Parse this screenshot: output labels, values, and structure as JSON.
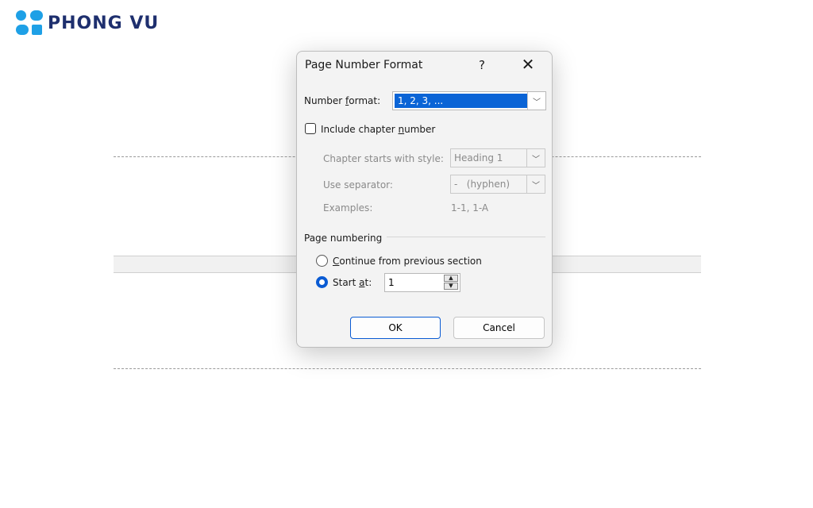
{
  "brand": {
    "name": "PHONG VU",
    "color": "#1e2f6e",
    "accent": "#1ea0e6"
  },
  "dialog": {
    "title": "Page Number Format",
    "help_label": "?",
    "close_label": "✕",
    "number_format": {
      "label_pre": "Number ",
      "label_u": "f",
      "label_post": "ormat:",
      "value": "1, 2, 3, ..."
    },
    "include_chapter": {
      "label_pre": "Include chapter ",
      "label_u": "n",
      "label_post": "umber",
      "checked": false
    },
    "chapter_style": {
      "label": "Chapter starts with style:",
      "value": "Heading 1"
    },
    "separator": {
      "label": "Use separator:",
      "value": "-   (hyphen)"
    },
    "examples": {
      "label": "Examples:",
      "value": "1-1, 1-A"
    },
    "page_numbering": {
      "group_label": "Page numbering",
      "continue": {
        "label_u": "C",
        "label_post": "ontinue from previous section",
        "selected": false
      },
      "start_at": {
        "label_pre": "Start ",
        "label_u": "a",
        "label_post": "t:",
        "selected": true,
        "value": "1"
      }
    },
    "ok_label": "OK",
    "cancel_label": "Cancel"
  },
  "colors": {
    "selection": "#0a64d6",
    "primary_border": "#0a5bd3"
  }
}
